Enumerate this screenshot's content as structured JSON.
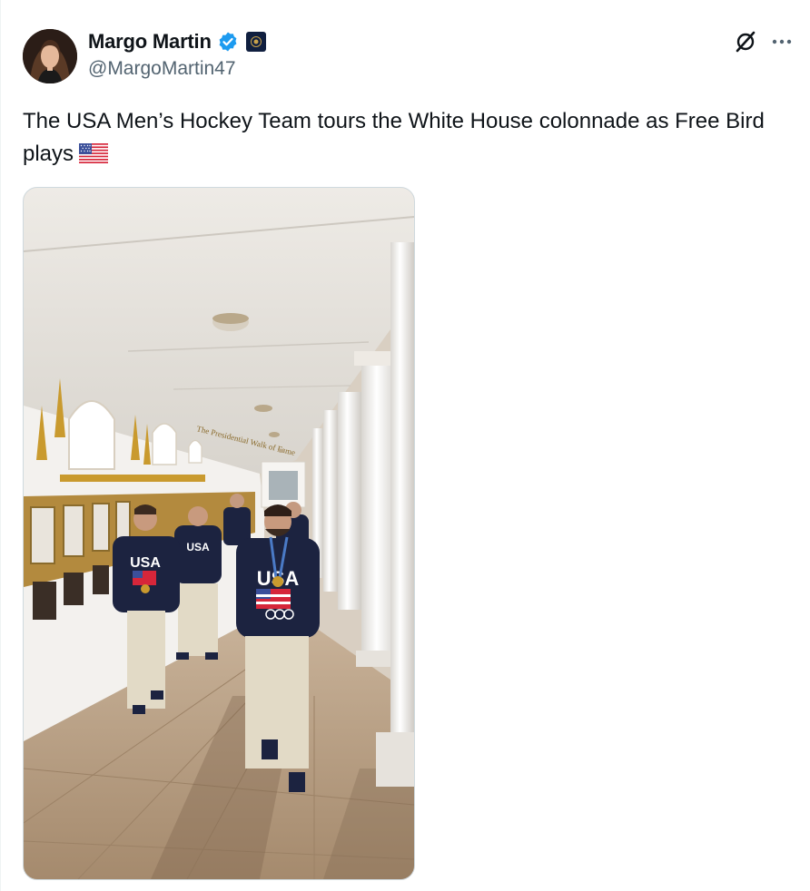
{
  "author": {
    "display_name": "Margo Martin",
    "handle": "@MargoMartin47",
    "verified_icon": "verified-badge-icon",
    "affiliate_icon": "affiliate-badge-icon"
  },
  "tweet": {
    "text": "The USA Men’s Hockey Team tours the White House colonnade as Free Bird plays",
    "emoji": "us-flag-emoji"
  },
  "media": {
    "sweater_text": "USA",
    "sign_text": "The Presidential Walk of Fame"
  },
  "actions": {
    "grok_icon": "grok-icon",
    "more_icon": "more-dots-icon"
  },
  "colors": {
    "text_primary": "#0f1419",
    "text_secondary": "#536471",
    "verified_blue": "#1d9bf0",
    "border": "#cfd9de",
    "sweater_navy": "#1c2340"
  }
}
